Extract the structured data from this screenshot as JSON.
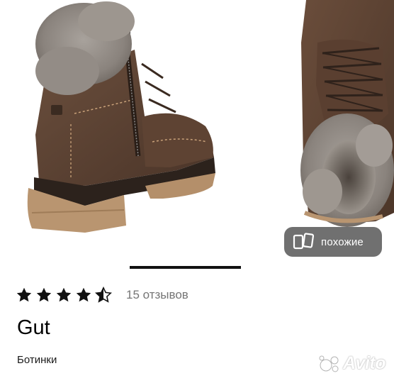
{
  "gallery": {
    "similar_button_label": "похожие",
    "similar_icon": "similar-cards-icon"
  },
  "rating": {
    "value": 4.5,
    "max": 5,
    "reviews_label": "15 отзывов"
  },
  "product": {
    "brand": "Gut",
    "category": "Ботинки"
  },
  "watermark": {
    "text": "Avito"
  },
  "colors": {
    "boot_brown": "#5b4334",
    "sole": "#b99570",
    "fur": "#8e8781",
    "button_bg": "#5c5c5c",
    "pager": "#111111",
    "reviews_text": "#757575"
  }
}
